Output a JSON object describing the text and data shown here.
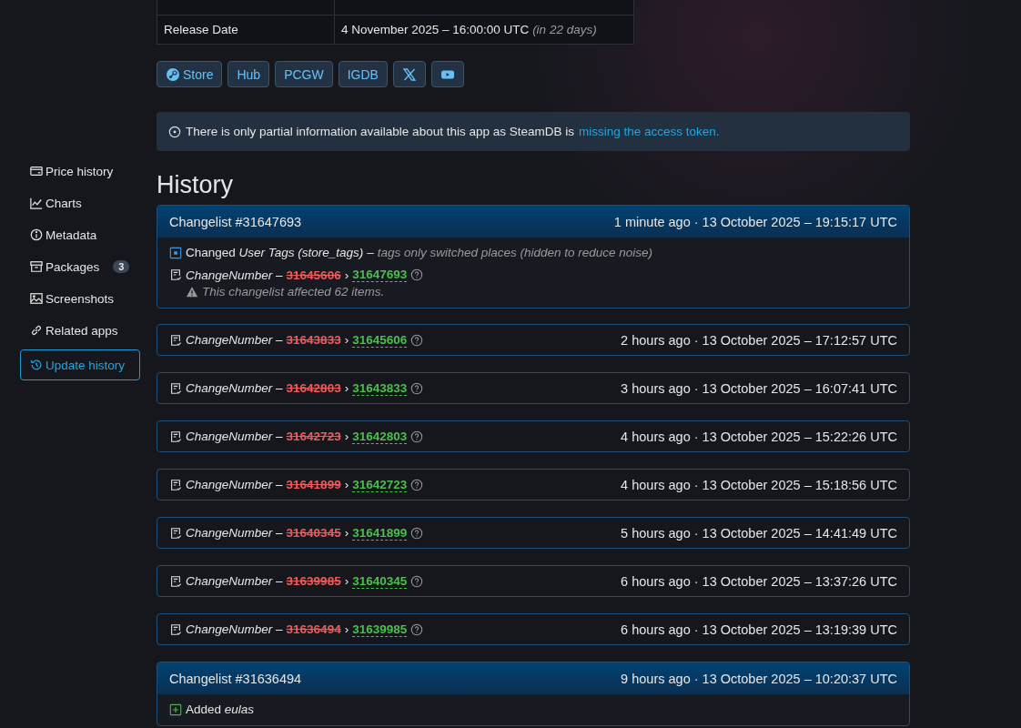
{
  "info_table": [
    {
      "label": "Release Date",
      "value": "4 November 2025 – 16:00:00 UTC",
      "note": "(in 22 days)"
    }
  ],
  "links": [
    {
      "kind": "steam",
      "label": "Store"
    },
    {
      "kind": "text",
      "label": "Hub"
    },
    {
      "kind": "text",
      "label": "PCGW"
    },
    {
      "kind": "text",
      "label": "IGDB"
    },
    {
      "kind": "x"
    },
    {
      "kind": "youtube"
    }
  ],
  "notice": {
    "text": "There is only partial information available about this app as SteamDB is",
    "link": "missing the access token."
  },
  "sidebar": {
    "items": [
      {
        "kind": "card",
        "label": "Price history",
        "selected": false
      },
      {
        "kind": "chart",
        "label": "Charts",
        "selected": false
      },
      {
        "kind": "info",
        "label": "Metadata",
        "selected": false
      },
      {
        "kind": "box",
        "label": "Packages",
        "badge": "3",
        "selected": false
      },
      {
        "kind": "image",
        "label": "Screenshots",
        "selected": false
      },
      {
        "kind": "link",
        "label": "Related apps",
        "selected": false
      },
      {
        "kind": "history",
        "label": "Update history",
        "selected": true
      }
    ]
  },
  "heading": "History",
  "changelists": [
    {
      "kind": "group",
      "title": "Changelist #31647693",
      "time": "1 minute ago · 13 October 2025 – 19:15:17 UTC",
      "entries": [
        {
          "kind": "changed",
          "text": "Changed *User Tags (store_tags)* –",
          "note": "tags only switched places (hidden to reduce noise)"
        },
        {
          "kind": "number",
          "field": "ChangeNumber –",
          "old": "31645606",
          "arrow": "›",
          "new": "31647693",
          "warning": "This changelist affected 62 items."
        }
      ]
    },
    {
      "kind": "row",
      "field": "ChangeNumber –",
      "old": "31643833",
      "arrow": "›",
      "new": "31645606",
      "time": "2 hours ago · 13 October 2025 – 17:12:57 UTC"
    },
    {
      "kind": "row",
      "field": "ChangeNumber –",
      "old": "31642803",
      "arrow": "›",
      "new": "31643833",
      "time": "3 hours ago · 13 October 2025 – 16:07:41 UTC"
    },
    {
      "kind": "row",
      "field": "ChangeNumber –",
      "old": "31642723",
      "arrow": "›",
      "new": "31642803",
      "time": "4 hours ago · 13 October 2025 – 15:22:26 UTC"
    },
    {
      "kind": "row",
      "field": "ChangeNumber –",
      "old": "31641899",
      "arrow": "›",
      "new": "31642723",
      "time": "4 hours ago · 13 October 2025 – 15:18:56 UTC"
    },
    {
      "kind": "row",
      "field": "ChangeNumber –",
      "old": "31640345",
      "arrow": "›",
      "new": "31641899",
      "time": "5 hours ago · 13 October 2025 – 14:41:49 UTC"
    },
    {
      "kind": "row",
      "field": "ChangeNumber –",
      "old": "31639985",
      "arrow": "›",
      "new": "31640345",
      "time": "6 hours ago · 13 October 2025 – 13:37:26 UTC"
    },
    {
      "kind": "row",
      "field": "ChangeNumber –",
      "old": "31636494",
      "arrow": "›",
      "new": "31639985",
      "time": "6 hours ago · 13 October 2025 – 13:19:39 UTC"
    },
    {
      "kind": "group",
      "title": "Changelist #31636494",
      "time": "9 hours ago · 13 October 2025 – 10:20:37 UTC",
      "entries": [
        {
          "kind": "added",
          "text": "Added *eulas*"
        }
      ]
    }
  ]
}
